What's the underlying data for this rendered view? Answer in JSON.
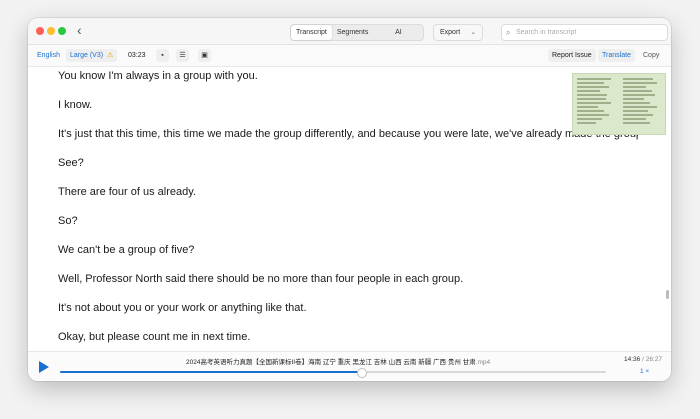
{
  "toolbar_top": {
    "tabs": [
      "Transcript",
      "Segments",
      "AI"
    ],
    "active_tab": "Transcript",
    "export_label": "Export",
    "export_chevron": "⌄",
    "search_placeholder": "Search in transcript"
  },
  "toolbar": {
    "language": "English",
    "model": "Large (V3)",
    "warning_icon": "⚠",
    "duration": "03:23",
    "report_issue": "Report Issue",
    "translate": "Translate",
    "copy": "Copy"
  },
  "transcript": {
    "lines": [
      "You know I'm always in a group with you.",
      "I know.",
      "It's just that this time, this time we made the group differently, and because you were late, we've already made the group.",
      "See?",
      "There are four of us already.",
      "So?",
      "We can't be a group of five?",
      "Well, Professor North said there should be no more than four people in each group.",
      "It's not about you or your work or anything like that.",
      "Okay, but please count me in next time."
    ]
  },
  "player": {
    "filename": "2024高考英语听力真题【全国新课标II卷】海南 辽宁 重庆 黑龙江 吉林 山西 云南 新疆 广西 贵州 甘肃",
    "extension": ".mp4",
    "current_time": "14:36",
    "total_time": "/ 26:27",
    "speed": "1 ×",
    "progress": 0.5518
  }
}
